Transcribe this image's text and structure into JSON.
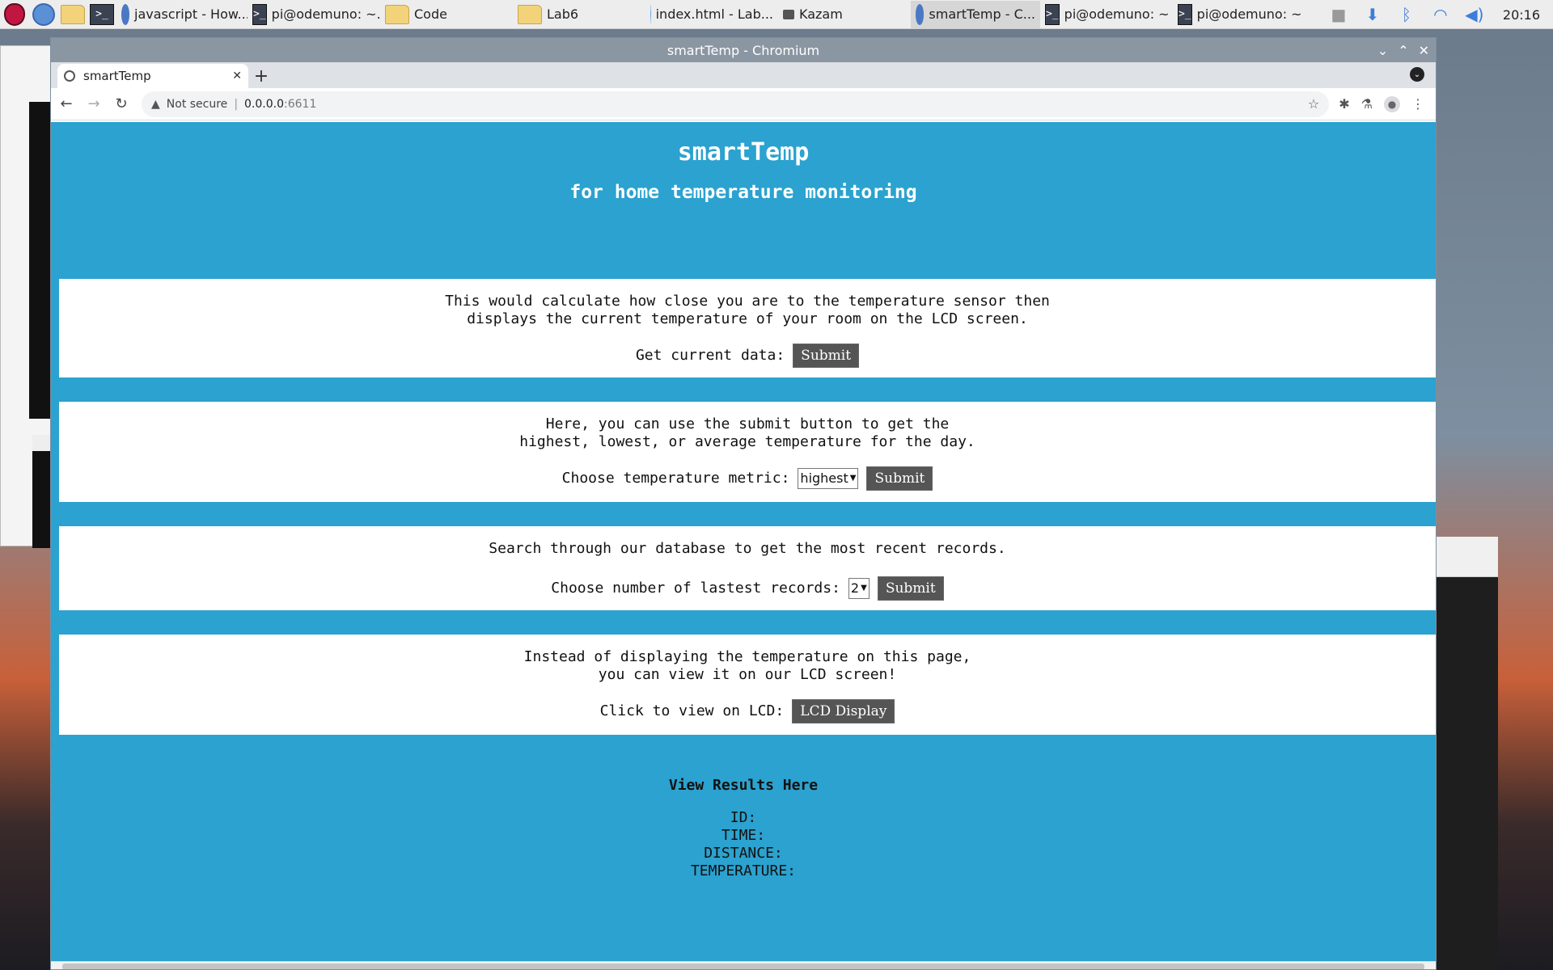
{
  "taskbar": {
    "tasks": [
      {
        "label": "javascript - How..."
      },
      {
        "label": "pi@odemuno: ~..."
      },
      {
        "label": "Code"
      },
      {
        "label": "Lab6"
      },
      {
        "label": "index.html - Lab..."
      },
      {
        "label": "Kazam"
      },
      {
        "label": "smartTemp - C..."
      },
      {
        "label": "pi@odemuno: ~"
      },
      {
        "label": "pi@odemuno: ~"
      }
    ],
    "clock": "20:16"
  },
  "browser": {
    "window_title": "smartTemp - Chromium",
    "tab_title": "smartTemp",
    "url_warning": "Not secure",
    "url_host": "0.0.0.0",
    "url_port": ":6611"
  },
  "page": {
    "title": "smartTemp",
    "subtitle": "for home temperature monitoring",
    "card1": {
      "line1": "This would calculate how close you are to the temperature sensor then",
      "line2": "displays the current temperature of your room on the LCD screen.",
      "label": "Get current data:",
      "button": "Submit"
    },
    "card2": {
      "line1": "Here, you can use the submit button to get the",
      "line2": "highest, lowest, or average temperature for the day.",
      "label": "Choose temperature metric:",
      "select_value": "highest",
      "button": "Submit"
    },
    "card3": {
      "line1": "Search through our database to get the most recent records.",
      "label": "Choose number of lastest records:",
      "select_value": "2",
      "button": "Submit"
    },
    "card4": {
      "line1": "Instead of displaying the temperature on this page,",
      "line2": "you can view it on our LCD screen!",
      "label": "Click to view on LCD:",
      "button": "LCD Display"
    },
    "results": {
      "title": "View Results Here",
      "id": "ID:",
      "time": "TIME:",
      "distance": "DISTANCE:",
      "temperature": "TEMPERATURE:"
    }
  }
}
